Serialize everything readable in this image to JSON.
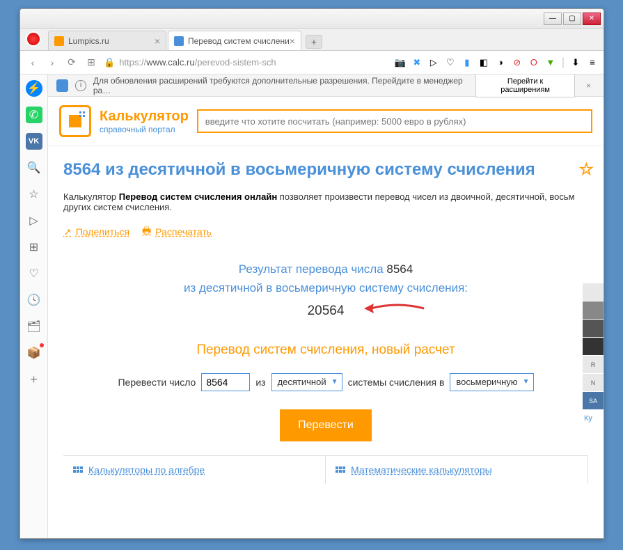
{
  "window": {
    "min": "—",
    "max": "▢",
    "close": "✕"
  },
  "tabs": {
    "tab1": "Lumpics.ru",
    "tab2": "Перевод систем счислени",
    "plus": "+"
  },
  "addr": {
    "back": "‹",
    "fwd": "›",
    "reload": "⟳",
    "speed": "⊞",
    "proto": "https://",
    "host": "www.calc.ru",
    "path": "/perevod-sistem-sch"
  },
  "notif": {
    "text": "Для обновления расширений требуются дополнительные разрешения. Перейдите в менеджер ра…",
    "btn": "Перейти к расширениям",
    "close": "×"
  },
  "brand": {
    "title": "Калькулятор",
    "sub": "справочный портал"
  },
  "search": {
    "placeholder": "введите что хотите посчитать (например: 5000 евро в рублях)"
  },
  "page": {
    "title": "8564 из десятичной в восьмеричную систему счисления",
    "desc_pre": "Калькулятор ",
    "desc_bold": "Перевод систем счисления онлайн",
    "desc_post": " позволяет произвести перевод чисел из двоичной, десятичной, восьм других систем счисления.",
    "share": "Поделиться",
    "print": "Распечатать",
    "res1": "Результат перевода числа ",
    "res1n": "8564",
    "res2": "из десятичной в восьмеричную систему счисления:",
    "res_val": "20564",
    "newcalc": "Перевод систем счисления, новый расчет",
    "form_l1": "Перевести число",
    "form_val": "8564",
    "form_l2": "из",
    "form_sel1": "десятичной",
    "form_l3": "системы счисления в",
    "form_sel2": "восьмеричную",
    "convert": "Перевести",
    "link1": "Калькуляторы по алгебре",
    "link2": "Математические калькуляторы",
    "ku": "Ку"
  },
  "strip": {
    "r": "R",
    "n": "N",
    "sa": "SA"
  }
}
